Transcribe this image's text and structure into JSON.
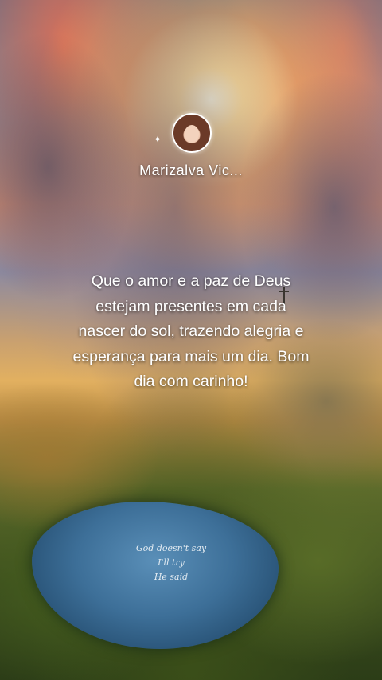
{
  "profile": {
    "name": "Marizalva Vic...",
    "avatar_icon": "profile-photo"
  },
  "post": {
    "message": "Que o amor e a paz de Deus estejam presentes em cada nascer do sol, trazendo alegria e esperança para mais um dia. Bom dia com carinho!"
  },
  "signature": {
    "line1": "God doesn't say",
    "line2": "I'll try",
    "line3": "He said"
  }
}
